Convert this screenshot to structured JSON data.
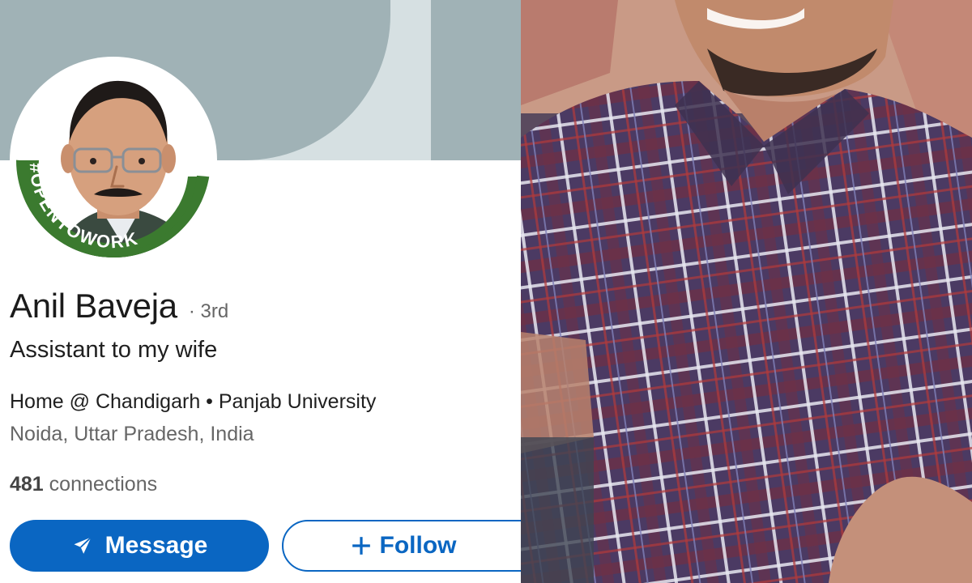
{
  "profile": {
    "name": "Anil Baveja",
    "degree": "· 3rd",
    "headline": "Assistant to my wife",
    "education": "Home @ Chandigarh • Panjab University",
    "location": "Noida, Uttar Pradesh, India",
    "connections_count": "481",
    "connections_label": "connections",
    "open_to_work_badge": "#OPENTOWORK"
  },
  "actions": {
    "message_label": "Message",
    "follow_label": "Follow"
  },
  "icons": {
    "message": "paper-plane-icon",
    "follow": "plus-icon"
  },
  "colors": {
    "primary": "#0a66c2",
    "open_to_work_green": "#3b7a2f",
    "banner_dark": "#a0b2b6",
    "banner_light": "#d6e0e2"
  }
}
